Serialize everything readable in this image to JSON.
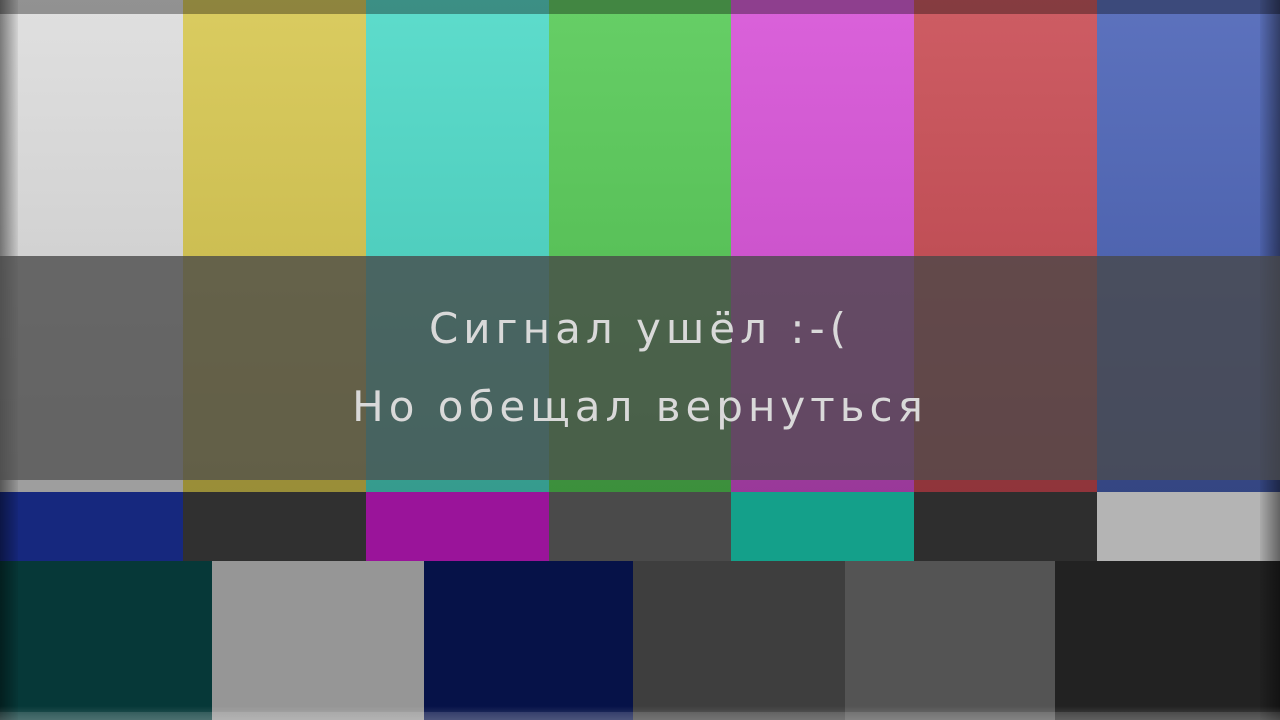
{
  "message": {
    "line1": "Сигнал ушёл :-(",
    "line2": "Но обещал вернуться"
  },
  "colors": {
    "top_bars": [
      "#dcdcdc",
      "#d6c64e",
      "#4bd8c6",
      "#55c955",
      "#d650d6",
      "#c84a52",
      "#4a62b6"
    ],
    "mid_bars": [
      "#16287e",
      "#303030",
      "#9a149a",
      "#4a4a4a",
      "#14a08a",
      "#2e2e2e",
      "#b4b4b4"
    ],
    "bottom_bars": [
      "#063838",
      "#969696",
      "#061248",
      "#3e3e3e",
      "#545454",
      "#222222"
    ],
    "overlay": "#484848",
    "text": "#d9d9d9"
  }
}
